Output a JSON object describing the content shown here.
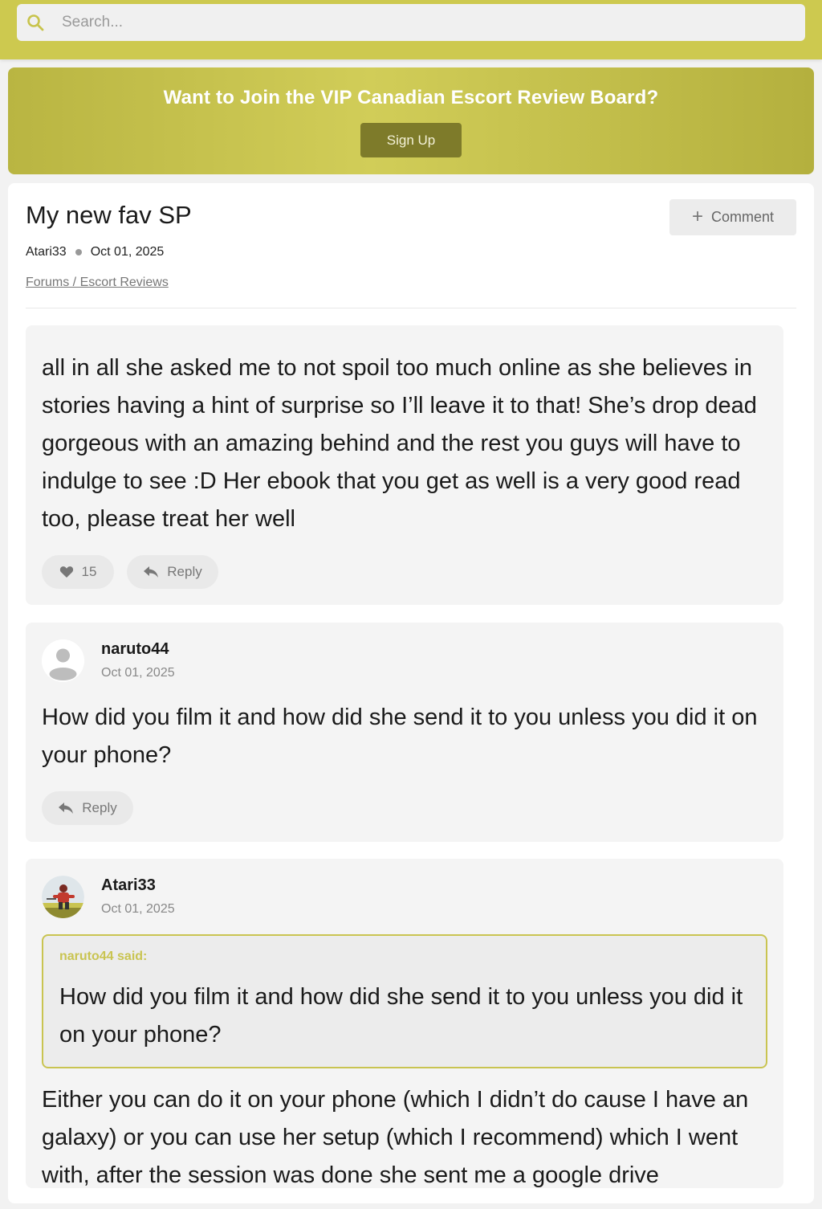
{
  "search": {
    "placeholder": "Search..."
  },
  "banner": {
    "title": "Want to Join the VIP Canadian Escort Review Board?",
    "signup_label": "Sign Up"
  },
  "thread": {
    "title": "My new fav SP",
    "author": "Atari33",
    "date": "Oct 01, 2025",
    "breadcrumb": "Forums / Escort Reviews",
    "comment_label": "Comment"
  },
  "posts": [
    {
      "body": "all in all she asked me to not spoil too much online as she believes in stories having a hint of surprise so I’ll leave it to that! She’s drop dead gorgeous with an amazing behind and the rest you guys will have to indulge to see :D Her ebook that you get as well is a very good read too, please treat her well",
      "likes": "15",
      "reply_label": "Reply"
    },
    {
      "author": "naruto44",
      "date": "Oct 01, 2025",
      "body": "How did you film it and how did she send it to you unless you did it on your phone?",
      "reply_label": "Reply"
    },
    {
      "author": "Atari33",
      "date": "Oct 01, 2025",
      "quote_header": "naruto44 said:",
      "quote_body": "How did you film it and how did she send it to you unless you did it on your phone?",
      "body": "Either you can do it on your phone (which I didn’t do cause I have an galaxy) or you can use her setup (which I recommend) which I went with, after the session was done she sent me a google drive"
    }
  ],
  "colors": {
    "accent": "#cdc94f",
    "button_dark": "#7e7b2a",
    "quote_border": "#c9c451"
  },
  "icons": {
    "search": "search-icon",
    "plus": "plus-icon",
    "heart": "heart-icon",
    "reply": "reply-icon",
    "avatar_default": "user-placeholder-icon"
  }
}
